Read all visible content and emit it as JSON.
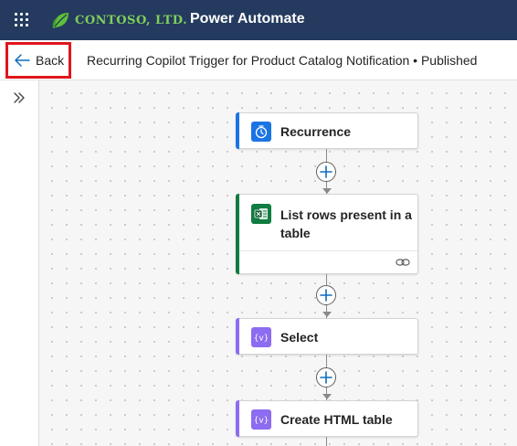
{
  "app": {
    "brand_name": "CONTOSO, LTD.",
    "product_name": "Power Automate"
  },
  "command_bar": {
    "back_label": "Back",
    "flow_title": "Recurring Copilot Trigger for Product Catalog Notification • Published"
  },
  "colors": {
    "app_bar": "#243a5e",
    "recurrence_accent": "#1b74e4",
    "excel_accent": "#107c41",
    "data_op_accent": "#8c6cf0",
    "highlight_border": "#e0161b"
  },
  "flow": {
    "steps": [
      {
        "title": "Recurrence",
        "icon": "clock-icon"
      },
      {
        "title": "List rows present in a table",
        "icon": "excel-icon",
        "footer_icon": "link-icon"
      },
      {
        "title": "Select",
        "icon": "variable-icon"
      },
      {
        "title": "Create HTML table",
        "icon": "variable-icon"
      }
    ]
  }
}
